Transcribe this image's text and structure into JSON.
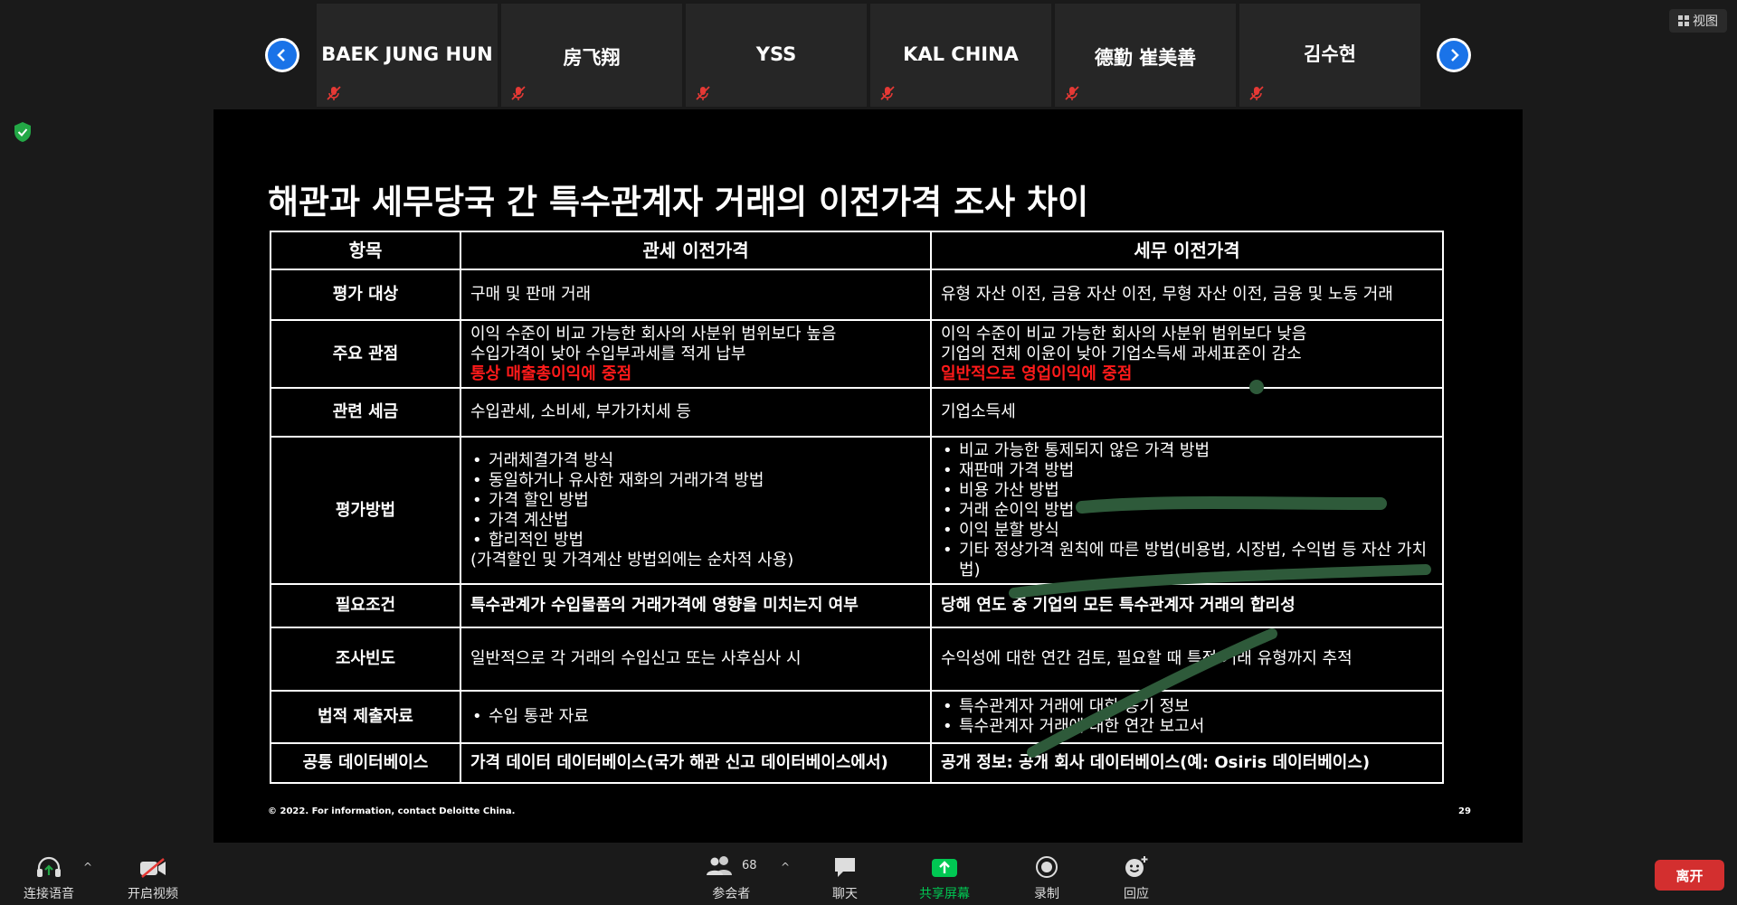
{
  "gallery": {
    "participants": [
      {
        "name": "BAEK JUNG HUN"
      },
      {
        "name": "房飞翔"
      },
      {
        "name": "YSS"
      },
      {
        "name": "KAL CHINA"
      },
      {
        "name": "德勤 崔美善"
      },
      {
        "name": "김수현"
      }
    ],
    "view_label": "视图"
  },
  "slide": {
    "title": "해관과 세무당국 간 특수관계자 거래의 이전가격 조사 차이",
    "headers": [
      "항목",
      "관세 이전가격",
      "세무 이전가격"
    ],
    "rows": {
      "eval_target": {
        "label": "평가 대상",
        "customs": "구매 및 판매 거래",
        "tax": "유형 자산 이전, 금융 자산 이전, 무형 자산 이전, 금융 및 노동 거래"
      },
      "perspective": {
        "label": "주요 관점",
        "customs": [
          "이익 수준이 비교 가능한 회사의 사분위 범위보다 높음",
          "수입가격이 낮아 수입부과세를 적게 납부"
        ],
        "customs_red": "통상 매출총이익에 중점",
        "tax": [
          "이익 수준이 비교 가능한 회사의 사분위 범위보다 낮음",
          "기업의 전체 이윤이 낮아 기업소득세 과세표준이 감소"
        ],
        "tax_red": "일반적으로 영업이익에 중점"
      },
      "taxes": {
        "label": "관련 세금",
        "customs": "수입관세, 소비세, 부가가치세 등",
        "tax": "기업소득세"
      },
      "methods": {
        "label": "평가방법",
        "customs": [
          "거래체결가격 방식",
          "동일하거나 유사한 재화의 거래가격 방법",
          "가격 할인 방법",
          "가격 계산법",
          "합리적인 방법"
        ],
        "customs_note": "(가격할인 및 가격계산 방법외에는 순차적 사용)",
        "tax": [
          "비교 가능한 통제되지 않은 가격 방법",
          "재판매 가격 방법",
          "비용 가산 방법",
          "거래 순이익 방법",
          "이익 분할 방식",
          "기타 정상가격 원칙에 따른 방법(비용법, 시장법, 수익법 등 자산 가치법)"
        ]
      },
      "requirement": {
        "label": "필요조건",
        "customs": "특수관계가 수입물품의 거래가격에 영향을 미치는지 여부",
        "tax": "당해 연도 중 기업의 모든 특수관계자 거래의 합리성"
      },
      "frequency": {
        "label": "조사빈도",
        "customs": "일반적으로 각 거래의 수입신고 또는 사후심사 시",
        "tax": "수익성에 대한 연간 검토, 필요할 때 특정 거래 유형까지 추적"
      },
      "documents": {
        "label": "법적 제출자료",
        "customs": [
          "수입 통관 자료"
        ],
        "tax": [
          "특수관계자 거래에 대한 동기 정보",
          "특수관계자 거래에 대한 연간 보고서"
        ]
      },
      "database": {
        "label": "공통 데이터베이스",
        "customs": "가격 데이터 데이터베이스(국가 해관 신고 데이터베이스에서)",
        "tax": "공개 정보: 공개 회사 데이터베이스(예: Osiris 데이터베이스)"
      }
    },
    "footer": "© 2022. For information, contact Deloitte China.",
    "page_number": "29"
  },
  "toolbar": {
    "audio": "连接语音",
    "video": "开启视频",
    "participants": "参会者",
    "participants_count": "68",
    "chat": "聊天",
    "share": "共享屏幕",
    "record": "录制",
    "reactions": "回应",
    "leave": "离开"
  },
  "colors": {
    "accent": "#1a73e8",
    "share_green": "#00c853",
    "leave_red": "#d32f2f",
    "emphasis_red": "#ff1a1a"
  }
}
